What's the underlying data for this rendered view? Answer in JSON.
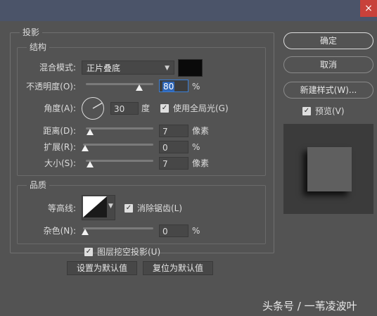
{
  "window": {
    "close_label": "×"
  },
  "shadow_group": {
    "title": "投影",
    "structure": {
      "title": "结构",
      "blend_mode": {
        "label": "混合模式:",
        "value": "正片叠底",
        "swatch_color": "#0a0a0a"
      },
      "opacity": {
        "label": "不透明度(O):",
        "value": "80",
        "unit": "%",
        "slider_level_percent": 80
      },
      "angle": {
        "label": "角度(A):",
        "value": "30",
        "unit": "度",
        "degrees": 30
      },
      "global_light": {
        "label": "使用全局光(G)",
        "checked": true
      },
      "distance": {
        "label": "距离(D):",
        "value": "7",
        "unit": "像素",
        "slider_level_percent": 3
      },
      "spread": {
        "label": "扩展(R):",
        "value": "0",
        "unit": "%",
        "slider_level_percent": 0
      },
      "size": {
        "label": "大小(S):",
        "value": "7",
        "unit": "像素",
        "slider_level_percent": 3
      }
    },
    "quality": {
      "title": "品质",
      "contour": {
        "label": "等高线:"
      },
      "anti_alias": {
        "label": "消除锯齿(L)",
        "checked": true
      },
      "noise": {
        "label": "杂色(N):",
        "value": "0",
        "unit": "%",
        "slider_level_percent": 0
      }
    },
    "layer_knockout": {
      "label": "图层挖空投影(U)",
      "checked": true
    },
    "set_default_label": "设置为默认值",
    "reset_default_label": "复位为默认值"
  },
  "side_panel": {
    "ok_label": "确定",
    "cancel_label": "取消",
    "new_style_label": "新建样式(W)...",
    "preview": {
      "label": "预览(V)",
      "checked": true
    }
  },
  "watermark": "头条号 / 一苇凌波叶",
  "colors": {
    "background": "#535353",
    "titlebar": "#4b5469",
    "close": "#c8413b",
    "focus": "#3b7fd6"
  }
}
